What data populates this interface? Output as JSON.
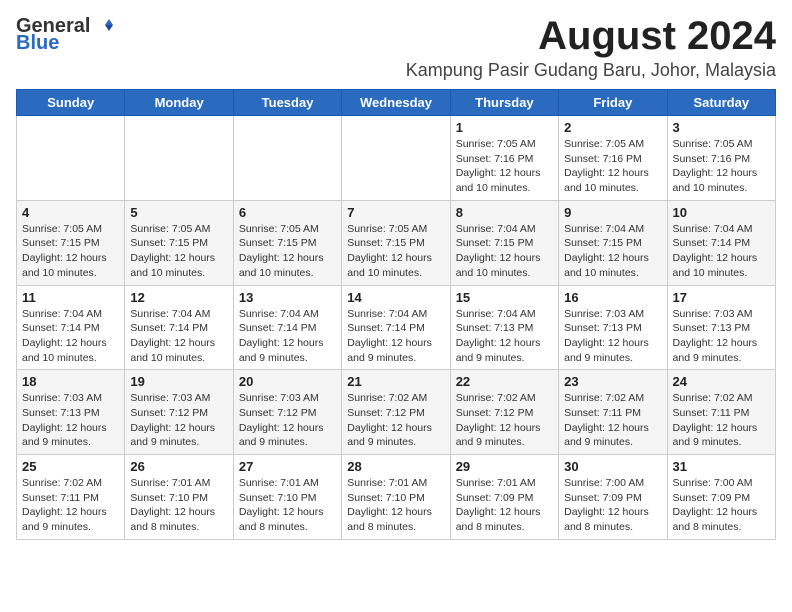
{
  "logo": {
    "general": "General",
    "blue": "Blue"
  },
  "title": {
    "month_year": "August 2024",
    "location": "Kampung Pasir Gudang Baru, Johor, Malaysia"
  },
  "days_of_week": [
    "Sunday",
    "Monday",
    "Tuesday",
    "Wednesday",
    "Thursday",
    "Friday",
    "Saturday"
  ],
  "weeks": [
    [
      {
        "day": "",
        "info": ""
      },
      {
        "day": "",
        "info": ""
      },
      {
        "day": "",
        "info": ""
      },
      {
        "day": "",
        "info": ""
      },
      {
        "day": "1",
        "info": "Sunrise: 7:05 AM\nSunset: 7:16 PM\nDaylight: 12 hours\nand 10 minutes."
      },
      {
        "day": "2",
        "info": "Sunrise: 7:05 AM\nSunset: 7:16 PM\nDaylight: 12 hours\nand 10 minutes."
      },
      {
        "day": "3",
        "info": "Sunrise: 7:05 AM\nSunset: 7:16 PM\nDaylight: 12 hours\nand 10 minutes."
      }
    ],
    [
      {
        "day": "4",
        "info": "Sunrise: 7:05 AM\nSunset: 7:15 PM\nDaylight: 12 hours\nand 10 minutes."
      },
      {
        "day": "5",
        "info": "Sunrise: 7:05 AM\nSunset: 7:15 PM\nDaylight: 12 hours\nand 10 minutes."
      },
      {
        "day": "6",
        "info": "Sunrise: 7:05 AM\nSunset: 7:15 PM\nDaylight: 12 hours\nand 10 minutes."
      },
      {
        "day": "7",
        "info": "Sunrise: 7:05 AM\nSunset: 7:15 PM\nDaylight: 12 hours\nand 10 minutes."
      },
      {
        "day": "8",
        "info": "Sunrise: 7:04 AM\nSunset: 7:15 PM\nDaylight: 12 hours\nand 10 minutes."
      },
      {
        "day": "9",
        "info": "Sunrise: 7:04 AM\nSunset: 7:15 PM\nDaylight: 12 hours\nand 10 minutes."
      },
      {
        "day": "10",
        "info": "Sunrise: 7:04 AM\nSunset: 7:14 PM\nDaylight: 12 hours\nand 10 minutes."
      }
    ],
    [
      {
        "day": "11",
        "info": "Sunrise: 7:04 AM\nSunset: 7:14 PM\nDaylight: 12 hours\nand 10 minutes."
      },
      {
        "day": "12",
        "info": "Sunrise: 7:04 AM\nSunset: 7:14 PM\nDaylight: 12 hours\nand 10 minutes."
      },
      {
        "day": "13",
        "info": "Sunrise: 7:04 AM\nSunset: 7:14 PM\nDaylight: 12 hours\nand 9 minutes."
      },
      {
        "day": "14",
        "info": "Sunrise: 7:04 AM\nSunset: 7:14 PM\nDaylight: 12 hours\nand 9 minutes."
      },
      {
        "day": "15",
        "info": "Sunrise: 7:04 AM\nSunset: 7:13 PM\nDaylight: 12 hours\nand 9 minutes."
      },
      {
        "day": "16",
        "info": "Sunrise: 7:03 AM\nSunset: 7:13 PM\nDaylight: 12 hours\nand 9 minutes."
      },
      {
        "day": "17",
        "info": "Sunrise: 7:03 AM\nSunset: 7:13 PM\nDaylight: 12 hours\nand 9 minutes."
      }
    ],
    [
      {
        "day": "18",
        "info": "Sunrise: 7:03 AM\nSunset: 7:13 PM\nDaylight: 12 hours\nand 9 minutes."
      },
      {
        "day": "19",
        "info": "Sunrise: 7:03 AM\nSunset: 7:12 PM\nDaylight: 12 hours\nand 9 minutes."
      },
      {
        "day": "20",
        "info": "Sunrise: 7:03 AM\nSunset: 7:12 PM\nDaylight: 12 hours\nand 9 minutes."
      },
      {
        "day": "21",
        "info": "Sunrise: 7:02 AM\nSunset: 7:12 PM\nDaylight: 12 hours\nand 9 minutes."
      },
      {
        "day": "22",
        "info": "Sunrise: 7:02 AM\nSunset: 7:12 PM\nDaylight: 12 hours\nand 9 minutes."
      },
      {
        "day": "23",
        "info": "Sunrise: 7:02 AM\nSunset: 7:11 PM\nDaylight: 12 hours\nand 9 minutes."
      },
      {
        "day": "24",
        "info": "Sunrise: 7:02 AM\nSunset: 7:11 PM\nDaylight: 12 hours\nand 9 minutes."
      }
    ],
    [
      {
        "day": "25",
        "info": "Sunrise: 7:02 AM\nSunset: 7:11 PM\nDaylight: 12 hours\nand 9 minutes."
      },
      {
        "day": "26",
        "info": "Sunrise: 7:01 AM\nSunset: 7:10 PM\nDaylight: 12 hours\nand 8 minutes."
      },
      {
        "day": "27",
        "info": "Sunrise: 7:01 AM\nSunset: 7:10 PM\nDaylight: 12 hours\nand 8 minutes."
      },
      {
        "day": "28",
        "info": "Sunrise: 7:01 AM\nSunset: 7:10 PM\nDaylight: 12 hours\nand 8 minutes."
      },
      {
        "day": "29",
        "info": "Sunrise: 7:01 AM\nSunset: 7:09 PM\nDaylight: 12 hours\nand 8 minutes."
      },
      {
        "day": "30",
        "info": "Sunrise: 7:00 AM\nSunset: 7:09 PM\nDaylight: 12 hours\nand 8 minutes."
      },
      {
        "day": "31",
        "info": "Sunrise: 7:00 AM\nSunset: 7:09 PM\nDaylight: 12 hours\nand 8 minutes."
      }
    ]
  ]
}
